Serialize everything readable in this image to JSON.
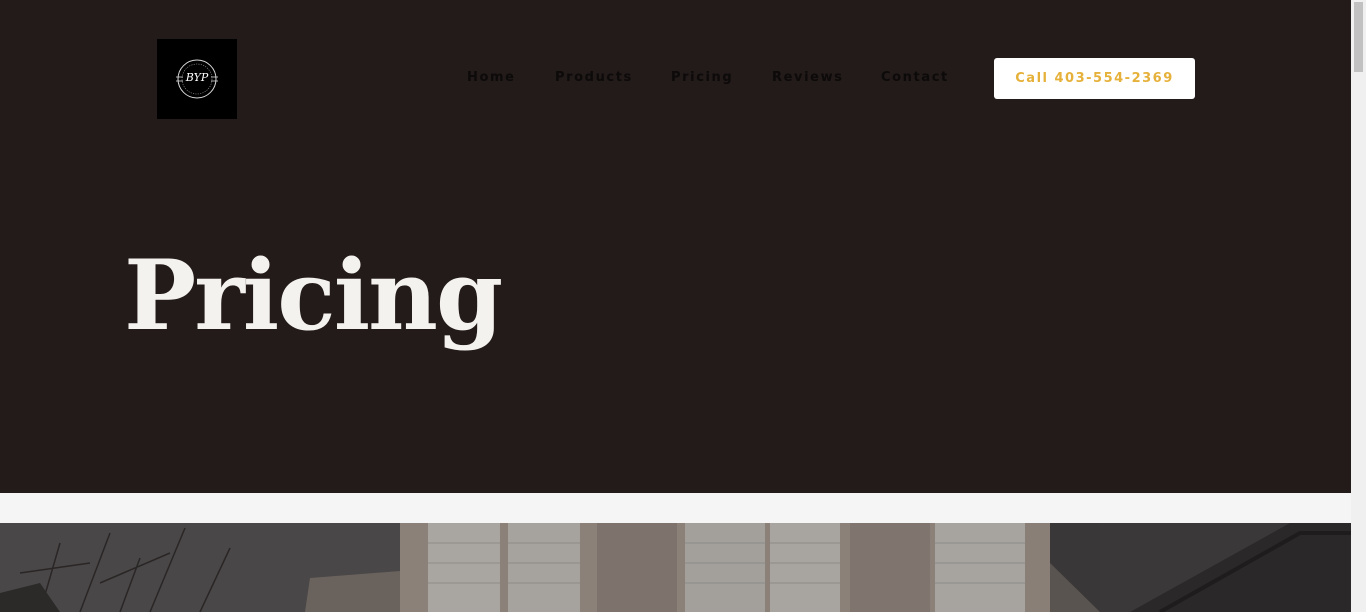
{
  "brand": {
    "logo_text": "BYP",
    "logo_ring_text": "",
    "bg_color": "#231a1a"
  },
  "nav": {
    "items": [
      {
        "label": "Home"
      },
      {
        "label": "Products"
      },
      {
        "label": "Pricing"
      },
      {
        "label": "Reviews"
      },
      {
        "label": "Contact"
      }
    ]
  },
  "cta": {
    "label": "Call 403-554-2369",
    "text_color": "#e6b13a"
  },
  "hero": {
    "title": "Pricing"
  },
  "icons": {
    "logo": "badge-logo-icon",
    "photo": "house-exterior-image"
  }
}
